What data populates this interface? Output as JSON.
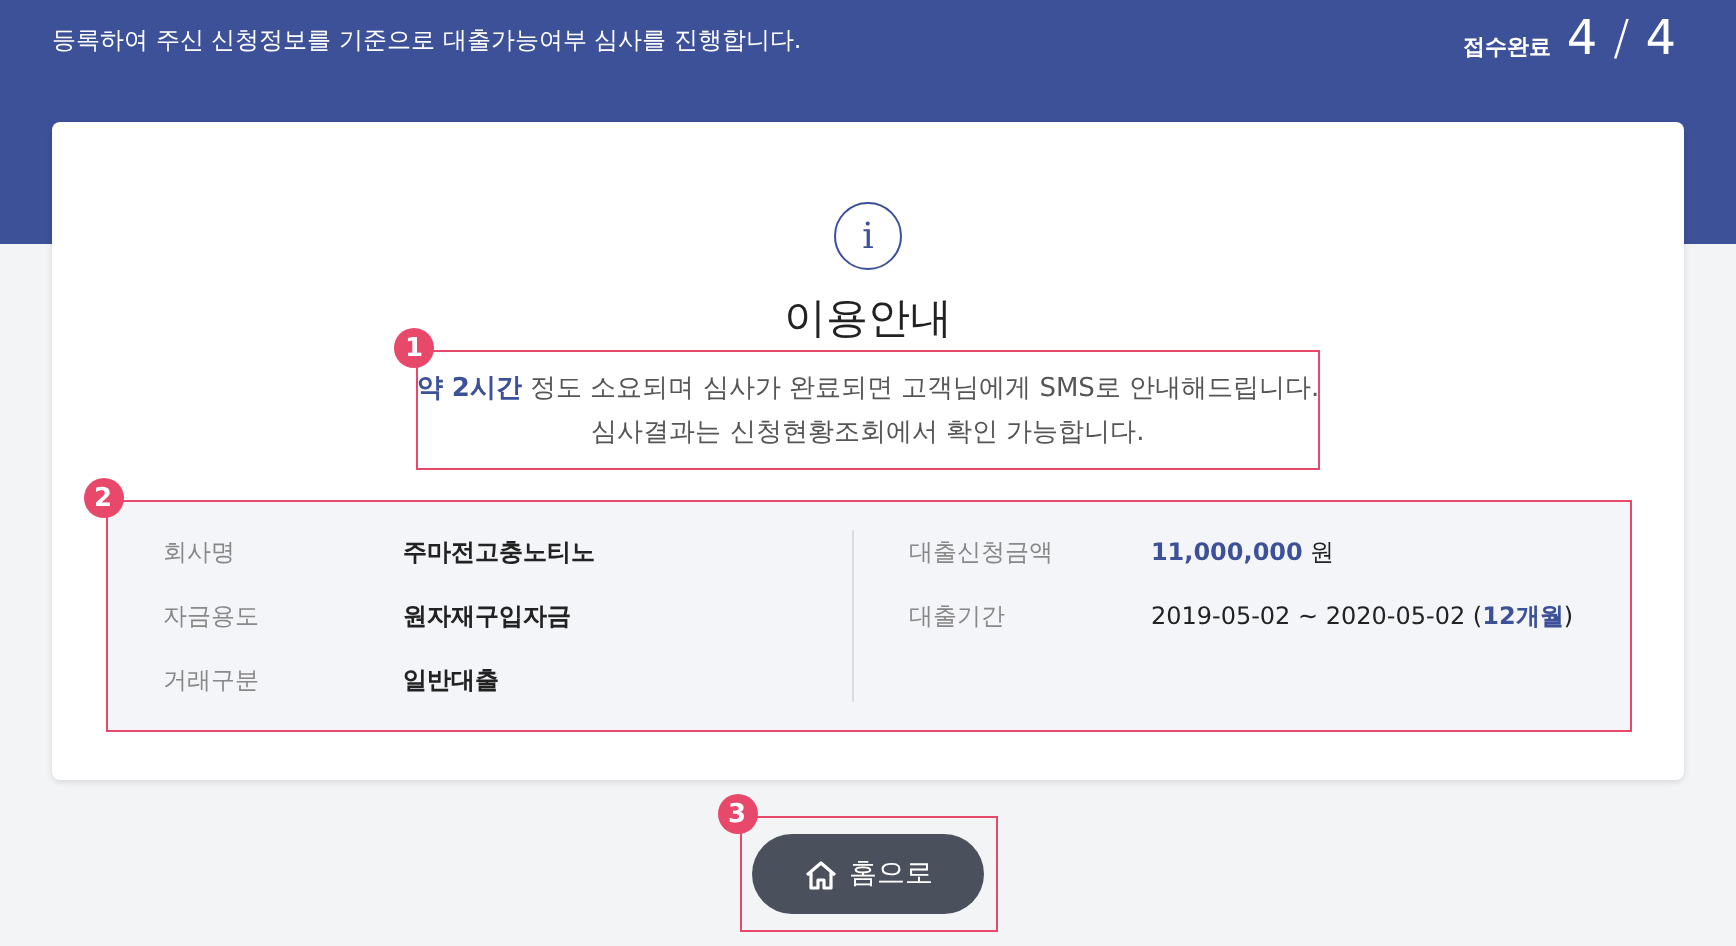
{
  "header": {
    "subtitle": "등록하여 주신 신청정보를 기준으로 대출가능여부 심사를 진행합니다.",
    "status_label": "접수완료",
    "step_current": "4",
    "step_separator": "/",
    "step_total": "4"
  },
  "notice": {
    "icon_glyph": "i",
    "title": "이용안내",
    "lines": [
      "**약 2시간** 정도 소요되며 심사가 완료되면 고객님에게 SMS로 안내해드립니다.",
      "심사결과는 신청현황조회에서 확인 가능합니다."
    ]
  },
  "details": {
    "left": [
      {
        "label": "회사명",
        "value": "주마전고충노티노"
      },
      {
        "label": "자금용도",
        "value": "원자재구입자금"
      },
      {
        "label": "거래구분",
        "value": "일반대출"
      }
    ],
    "right": [
      {
        "label": "대출신청금액",
        "value": "**11,000,000** 원"
      },
      {
        "label": "대출기간",
        "value": "2019-05-02 ~ 2020-05-02 (**12개월**)"
      }
    ]
  },
  "button": {
    "label": "홈으로"
  },
  "annotations": [
    {
      "number": "1"
    },
    {
      "number": "2"
    },
    {
      "number": "3"
    }
  ]
}
